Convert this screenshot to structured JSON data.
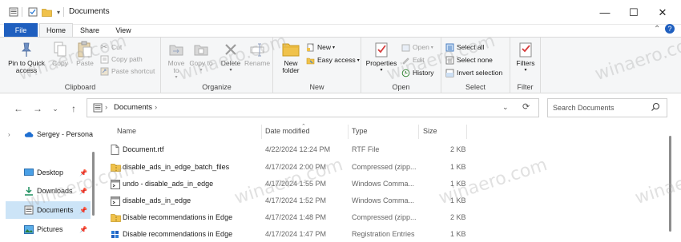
{
  "window": {
    "title": "Documents",
    "minimize_glyph": "—",
    "maximize_glyph": "☐",
    "close_glyph": "✕"
  },
  "ribbon_tabs": {
    "file": "File",
    "home": "Home",
    "share": "Share",
    "view": "View"
  },
  "clipboard": {
    "pin": "Pin to Quick access",
    "copy": "Copy",
    "paste": "Paste",
    "cut": "Cut",
    "copy_path": "Copy path",
    "paste_shortcut": "Paste shortcut",
    "label": "Clipboard"
  },
  "organize": {
    "move_to": "Move to",
    "copy_to": "Copy to",
    "delete": "Delete",
    "rename": "Rename",
    "label": "Organize"
  },
  "new_group": {
    "new_folder": "New folder",
    "new_item": "New",
    "easy_access": "Easy access",
    "label": "New"
  },
  "open_group": {
    "properties": "Properties",
    "open": "Open",
    "edit": "Edit",
    "history": "History",
    "label": "Open"
  },
  "select_group": {
    "select_all": "Select all",
    "select_none": "Select none",
    "invert": "Invert selection",
    "label": "Select"
  },
  "filter_group": {
    "filters": "Filters",
    "label": "Filter"
  },
  "address": {
    "segment": "Documents",
    "search_placeholder": "Search Documents"
  },
  "nav_pane": {
    "items": [
      {
        "label": "Sergey - Persona",
        "icon": "cloud-icon"
      },
      {
        "label": "Desktop",
        "icon": "desktop-icon"
      },
      {
        "label": "Downloads",
        "icon": "download-icon"
      },
      {
        "label": "Documents",
        "icon": "document-folder-icon"
      },
      {
        "label": "Pictures",
        "icon": "picture-icon"
      }
    ]
  },
  "columns": {
    "name": "Name",
    "date": "Date modified",
    "type": "Type",
    "size": "Size"
  },
  "files": [
    {
      "name": "Document.rtf",
      "date": "4/22/2024 12:24 PM",
      "type": "RTF File",
      "size": "2 KB",
      "icon": "rtf-file-icon"
    },
    {
      "name": "disable_ads_in_edge_batch_files",
      "date": "4/17/2024 2:00 PM",
      "type": "Compressed (zipp...",
      "size": "1 KB",
      "icon": "zip-folder-icon"
    },
    {
      "name": "undo - disable_ads_in_edge",
      "date": "4/17/2024 1:55 PM",
      "type": "Windows Comma...",
      "size": "1 KB",
      "icon": "batch-file-icon"
    },
    {
      "name": "disable_ads_in_edge",
      "date": "4/17/2024 1:52 PM",
      "type": "Windows Comma...",
      "size": "1 KB",
      "icon": "batch-file-icon"
    },
    {
      "name": "Disable recommendations in Edge",
      "date": "4/17/2024 1:48 PM",
      "type": "Compressed (zipp...",
      "size": "2 KB",
      "icon": "zip-folder-icon"
    },
    {
      "name": "Disable recommendations in Edge",
      "date": "4/17/2024 1:47 PM",
      "type": "Registration Entries",
      "size": "1 KB",
      "icon": "registry-file-icon"
    }
  ],
  "watermark": "winaero.com",
  "colors": {
    "accent": "#1f5fbf",
    "selected": "#cce4f7",
    "folder": "#f0c24b"
  }
}
